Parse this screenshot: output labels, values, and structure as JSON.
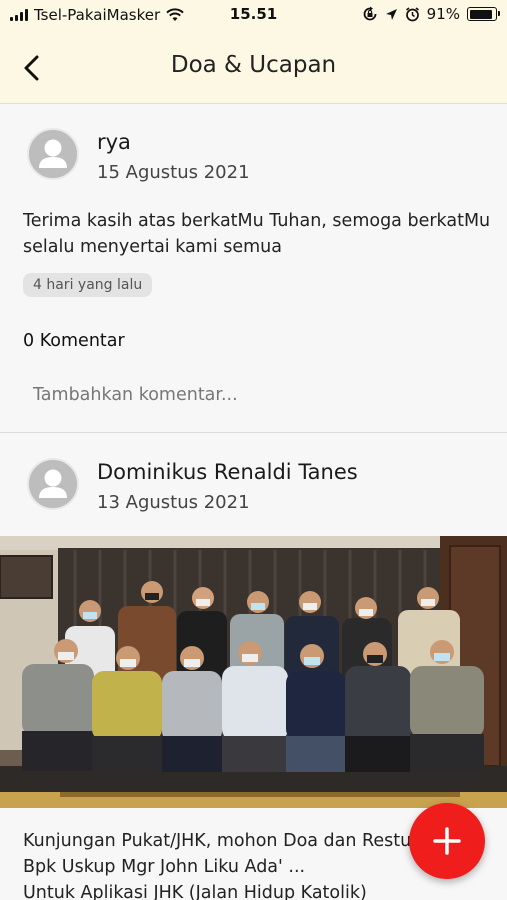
{
  "status_bar": {
    "carrier": "Tsel-PakaiMasker",
    "time": "15.51",
    "battery_percent": "91%",
    "battery_level": 0.91,
    "icons": [
      "signal-icon",
      "wifi-icon",
      "screen-lock-icon",
      "location-icon",
      "alarm-icon",
      "battery-icon"
    ]
  },
  "header": {
    "title": "Doa & Ucapan",
    "back_icon": "chevron-left-icon"
  },
  "posts": [
    {
      "author": "rya",
      "date": "15 Agustus 2021",
      "text": "Terima kasih atas berkatMu Tuhan, semoga berkatMu selalu menyertai kami semua",
      "time_ago": "4 hari yang lalu",
      "comments_label": "0 Komentar",
      "comment_placeholder": "Tambahkan komentar..."
    },
    {
      "author": "Dominikus Renaldi Tanes",
      "date": "13 Agustus 2021",
      "has_photo": true,
      "text_lines": [
        "Kunjungan Pukat/JHK, mohon Doa dan Restu",
        "Bpk Uskup Mgr John Liku Ada' ...",
        "Untuk Aplikasi JHK (Jalan Hidup Katolik)"
      ]
    }
  ],
  "fab": {
    "label": "+",
    "icon": "plus-icon",
    "color": "#f01d1d"
  },
  "colors": {
    "header_bg": "#fdf8e4",
    "page_bg": "#f7f7f7",
    "avatar": "#bdbdbd"
  }
}
